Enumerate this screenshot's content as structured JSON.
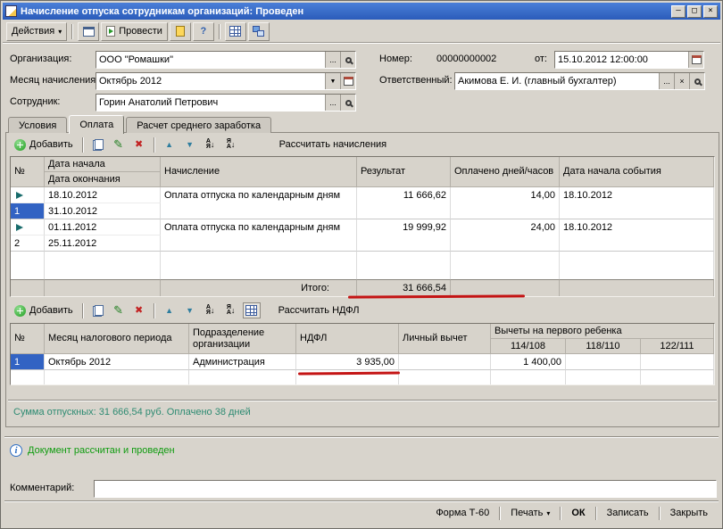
{
  "window": {
    "title": "Начисление отпуска сотрудникам организаций: Проведен",
    "controls": {
      "minimize": "–",
      "maximize": "□",
      "close": "×"
    }
  },
  "toolbar": {
    "actions": "Действия",
    "post": "Провести",
    "help": "?"
  },
  "glyphs": {
    "caret_down": "▾",
    "dropdown": "▼",
    "choose": "...",
    "clear": "×"
  },
  "fields": {
    "organization": {
      "label": "Организация:",
      "value": "ООО \"Ромашки\""
    },
    "accrual_month": {
      "label": "Месяц начисления:",
      "value": "Октябрь 2012"
    },
    "employee": {
      "label": "Сотрудник:",
      "value": "Горин Анатолий Петрович"
    },
    "number": {
      "label": "Номер:",
      "value": "00000000002"
    },
    "date": {
      "label": "от:",
      "value": "15.10.2012 12:00:00"
    },
    "responsible": {
      "label": "Ответственный:",
      "value": "Акимова Е. И. (главный бухгалтер)"
    }
  },
  "tabs": [
    {
      "label": "Условия"
    },
    {
      "label": "Оплата"
    },
    {
      "label": "Расчет среднего заработка"
    }
  ],
  "accruals": {
    "toolbar": {
      "add": "Добавить",
      "calculate": "Рассчитать начисления"
    },
    "header": {
      "num": "№",
      "date_start": "Дата начала",
      "date_end": "Дата окончания",
      "accrual": "Начисление",
      "result": "Результат",
      "paid_days": "Оплачено дней/часов",
      "event_date": "Дата начала события"
    },
    "rows": [
      {
        "num": "1",
        "date_start": "18.10.2012",
        "date_end": "31.10.2012",
        "accrual": "Оплата отпуска по календарным дням",
        "result": "11 666,62",
        "paid_days": "14,00",
        "event_date": "18.10.2012"
      },
      {
        "num": "2",
        "date_start": "01.11.2012",
        "date_end": "25.11.2012",
        "accrual": "Оплата отпуска по календарным дням",
        "result": "19 999,92",
        "paid_days": "24,00",
        "event_date": "18.10.2012"
      }
    ],
    "total": {
      "label": "Итого:",
      "value": "31 666,54"
    }
  },
  "ndfl": {
    "toolbar": {
      "add": "Добавить",
      "calculate": "Рассчитать НДФЛ"
    },
    "header": {
      "num": "№",
      "month": "Месяц налогового периода",
      "division": "Подразделение организации",
      "ndfl": "НДФЛ",
      "personal": "Личный вычет",
      "first_child_group": "Вычеты на первого ребенка",
      "code1": "114/108",
      "code2": "118/110",
      "code3": "122/111"
    },
    "rows": [
      {
        "num": "1",
        "month": "Октябрь 2012",
        "division": "Администрация",
        "ndfl": "3 935,00",
        "personal": "",
        "code1": "1 400,00",
        "code2": "",
        "code3": ""
      }
    ]
  },
  "status": {
    "summary": "Сумма отпускных: 31 666,54 руб. Оплачено 38 дней",
    "info": "Документ рассчитан и проведен"
  },
  "comment": {
    "label": "Комментарий:",
    "value": ""
  },
  "footer": {
    "form_t60": "Форма Т-60",
    "print": "Печать",
    "ok": "ОК",
    "save": "Записать",
    "close": "Закрыть"
  },
  "colors": {
    "titlebar": "#3a6ed8",
    "selection": "#3263c3",
    "summary_text": "#2e8b72",
    "info_text": "#0f9b0f",
    "annotation_red": "#c41414",
    "window_bg": "#d8d4cc"
  }
}
